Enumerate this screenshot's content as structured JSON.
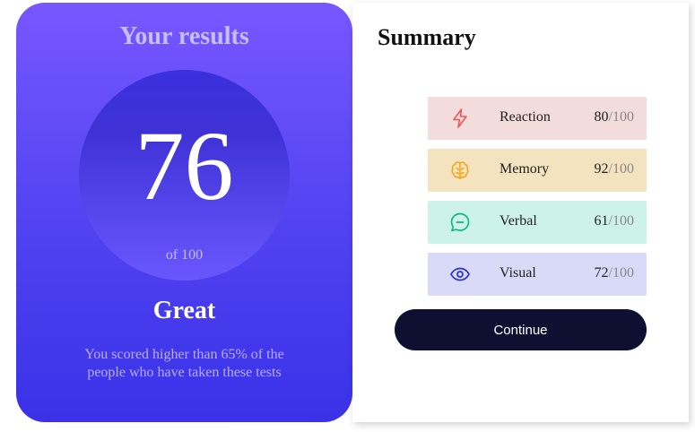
{
  "results": {
    "title": "Your results",
    "score": "76",
    "score_max": "of 100",
    "rating": "Great",
    "description": "You scored higher than 65% of the people who have taken these tests"
  },
  "summary": {
    "title": "Summary",
    "items": [
      {
        "label": "Reaction",
        "score": "80",
        "max": "/100",
        "icon": "lightning-icon",
        "bg": "#f3dcdc",
        "icon_color": "#ef5656"
      },
      {
        "label": "Memory",
        "score": "92",
        "max": "/100",
        "icon": "brain-icon",
        "bg": "#f3e3bf",
        "icon_color": "#f3a51c"
      },
      {
        "label": "Verbal",
        "score": "61",
        "max": "/100",
        "icon": "chat-icon",
        "bg": "#cdf2e8",
        "icon_color": "#11b77f"
      },
      {
        "label": "Visual",
        "score": "72",
        "max": "/100",
        "icon": "eye-icon",
        "bg": "#d9daf8",
        "icon_color": "#2a2fd0"
      }
    ],
    "continue_label": "Continue"
  },
  "colors": {
    "card_gradient_top": "#7857ff",
    "card_gradient_bottom": "#3a31e8",
    "button_bg": "#0f1031"
  }
}
